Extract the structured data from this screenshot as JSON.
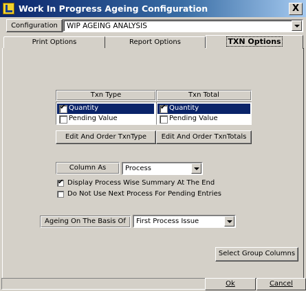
{
  "window": {
    "title": "Work In Progress Ageing Configuration",
    "close_label": "X"
  },
  "configuration": {
    "label": "Configuration",
    "value": "WIP AGEING ANALYSIS"
  },
  "tabs": [
    {
      "label": "Print Options",
      "active": false
    },
    {
      "label": "Report Options",
      "active": false
    },
    {
      "label": "TXN Options",
      "active": true
    }
  ],
  "txn_type": {
    "header": "Txn Type",
    "items": [
      {
        "label": "Quantity",
        "checked": true,
        "selected": true
      },
      {
        "label": "Pending Value",
        "checked": false,
        "selected": false
      }
    ],
    "edit_button": "Edit And Order TxnType"
  },
  "txn_total": {
    "header": "Txn Total",
    "items": [
      {
        "label": "Quantity",
        "checked": true,
        "selected": true
      },
      {
        "label": "Pending Value",
        "checked": false,
        "selected": false
      }
    ],
    "edit_button": "Edit And Order TxnTotals"
  },
  "column_as": {
    "label": "Column As",
    "value": "Process"
  },
  "options": {
    "display_summary": {
      "label": "Display Process Wise Summary At The End",
      "checked": true
    },
    "no_next_process": {
      "label": "Do Not Use Next Process For Pending Entries",
      "checked": false
    }
  },
  "ageing_basis": {
    "label": "Ageing On The Basis Of",
    "value": "First Process Issue"
  },
  "select_group_columns_label": "Select Group Columns",
  "footer": {
    "ok_label": "Ok",
    "cancel_label": "Cancel"
  }
}
